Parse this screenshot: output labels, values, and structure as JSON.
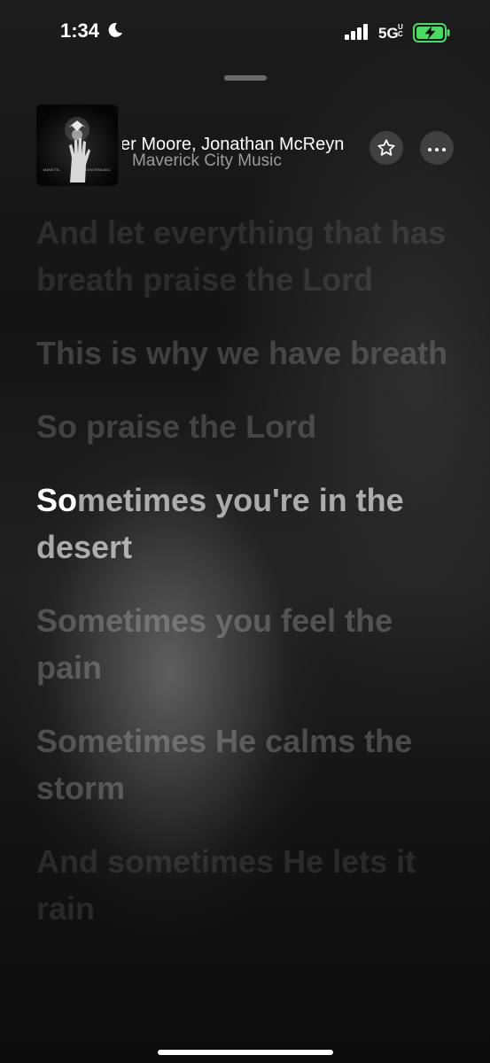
{
  "status_bar": {
    "time": "1:34",
    "network": "5G",
    "network_sub_top": "U",
    "network_sub_bottom": "C"
  },
  "now_playing": {
    "artists": "er Moore, Jonathan McReyn",
    "album": "Maverick City Music",
    "album_art_left_text": "MAVETIL",
    "album_art_right_text": "TONTEMUSIC"
  },
  "lyrics": [
    {
      "text": "And let everything that has breath praise the Lord",
      "state": "faded"
    },
    {
      "text": "This is why we have breath",
      "state": "past"
    },
    {
      "text": "So praise the Lord",
      "state": "past"
    },
    {
      "sung": "So",
      "rest": "metimes you're in the desert",
      "state": "active"
    },
    {
      "text": "Sometimes you feel the pain",
      "state": "upcoming"
    },
    {
      "text": "Sometimes He calms the storm",
      "state": "upcoming"
    },
    {
      "text": "And sometimes He lets it rain",
      "state": "faded"
    }
  ],
  "icons": {
    "moon": "moon-icon",
    "signal": "cellular-signal-icon",
    "battery": "battery-charging-icon",
    "favorite": "star-icon",
    "more": "ellipsis-icon"
  },
  "colors": {
    "battery_fill": "#4cd964",
    "sung_text": "#ffffff"
  }
}
